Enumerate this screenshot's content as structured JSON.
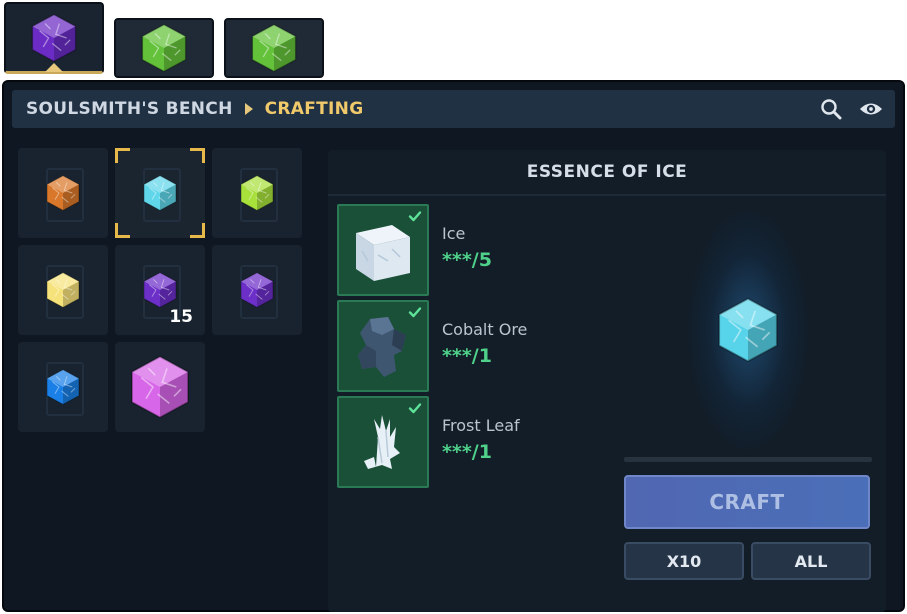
{
  "tabs": [
    {
      "icon": "purple-crystal-icon",
      "active": true
    },
    {
      "icon": "green-crystal-icon",
      "active": false
    },
    {
      "icon": "green-crystal-icon",
      "active": false
    }
  ],
  "header": {
    "breadcrumb_root": "SOULSMITH'S BENCH",
    "breadcrumb_current": "CRAFTING",
    "icons": [
      "search-icon",
      "eye-icon"
    ]
  },
  "recipes": [
    {
      "icon": "orange-crystal-icon",
      "color": "#d9782a",
      "selected": false,
      "quantity": ""
    },
    {
      "icon": "ice-crystal-icon",
      "color": "#5fd6ea",
      "selected": true,
      "quantity": ""
    },
    {
      "icon": "lime-crystal-icon",
      "color": "#a8e03c",
      "selected": false,
      "quantity": ""
    },
    {
      "icon": "yellow-crystal-icon",
      "color": "#f6e27a",
      "selected": false,
      "quantity": ""
    },
    {
      "icon": "purple-crystal-icon",
      "color": "#6c2fc8",
      "selected": false,
      "quantity": "15"
    },
    {
      "icon": "purple-crystal-icon",
      "color": "#6c2fc8",
      "selected": false,
      "quantity": ""
    },
    {
      "icon": "blue-crystal-icon",
      "color": "#1a7fe6",
      "selected": false,
      "quantity": ""
    },
    {
      "icon": "magenta-crystal-icon",
      "color": "#d766e8",
      "selected": false,
      "quantity": ""
    }
  ],
  "detail": {
    "title": "ESSENCE OF ICE",
    "ingredients": [
      {
        "name": "Ice",
        "count": "***/5",
        "icon": "ice-block-icon"
      },
      {
        "name": "Cobalt Ore",
        "count": "***/1",
        "icon": "cobalt-ore-icon"
      },
      {
        "name": "Frost Leaf",
        "count": "***/1",
        "icon": "frost-leaf-icon"
      }
    ],
    "craft_label": "CRAFT",
    "x10_label": "X10",
    "all_label": "ALL"
  },
  "colors": {
    "accent_gold": "#f0c96a",
    "ingredient_ok": "#4fd18a",
    "craft_button": "#5167b2"
  }
}
